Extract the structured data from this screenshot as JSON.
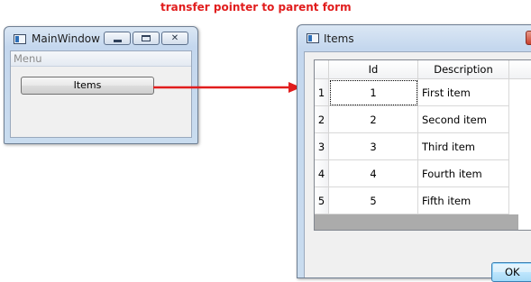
{
  "caption": "transfer pointer to parent form",
  "main_window": {
    "title": "MainWindow",
    "menu": "Menu",
    "items_button": "Items"
  },
  "items_dialog": {
    "title": "Items",
    "columns": [
      "Id",
      "Description"
    ],
    "rows": [
      {
        "row": "1",
        "id": "1",
        "description": "First item"
      },
      {
        "row": "2",
        "id": "2",
        "description": "Second item"
      },
      {
        "row": "3",
        "id": "3",
        "description": "Third item"
      },
      {
        "row": "4",
        "id": "4",
        "description": "Fourth item"
      },
      {
        "row": "5",
        "id": "5",
        "description": "Fifth item"
      }
    ],
    "ok_button": "OK"
  },
  "colors": {
    "caption": "#e11d1d",
    "arrow": "#e11d1d",
    "titlebar": "#c4d7ee"
  }
}
